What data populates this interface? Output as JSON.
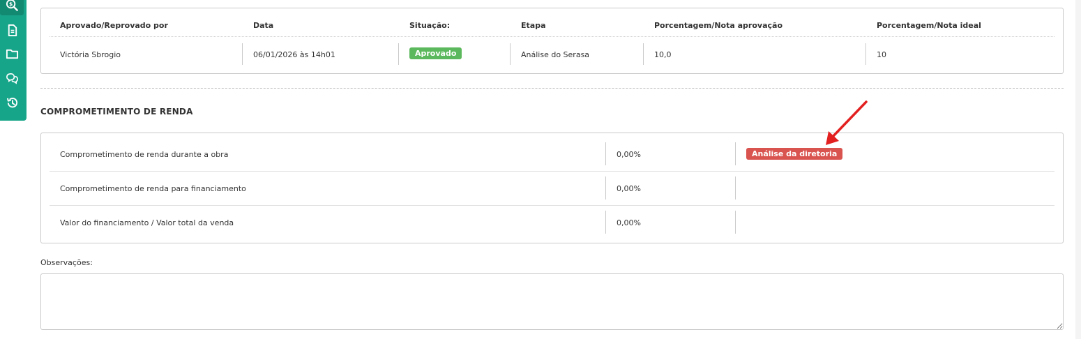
{
  "approvals": {
    "headers": [
      "Aprovado/Reprovado por",
      "Data",
      "Situação:",
      "Etapa",
      "Porcentagem/Nota aprovação",
      "Porcentagem/Nota ideal"
    ],
    "row": {
      "approver": "Victória Sbrogio",
      "date": "06/01/2026 às 14h01",
      "status": "Aprovado",
      "stage": "Análise do Serasa",
      "approval_score": "10,0",
      "ideal_score": "10"
    }
  },
  "income": {
    "title": "COMPROMETIMENTO DE RENDA",
    "rows": [
      {
        "label": "Comprometimento de renda durante a obra",
        "value": "0,00%",
        "badge": "Análise da diretoria"
      },
      {
        "label": "Comprometimento de renda para financiamento",
        "value": "0,00%"
      },
      {
        "label": "Valor do financiamento / Valor total da venda",
        "value": "0,00%"
      }
    ]
  },
  "observations": {
    "label": "Observações:",
    "value": ""
  },
  "sidebar": {
    "icons": [
      "money-search-icon",
      "document-icon",
      "folder-icon",
      "chat-icon",
      "history-icon"
    ]
  },
  "colors": {
    "sidebar": "#17a589",
    "approved": "#5cb85c",
    "director_review": "#d9534f",
    "annotation_arrow": "#e32020"
  }
}
